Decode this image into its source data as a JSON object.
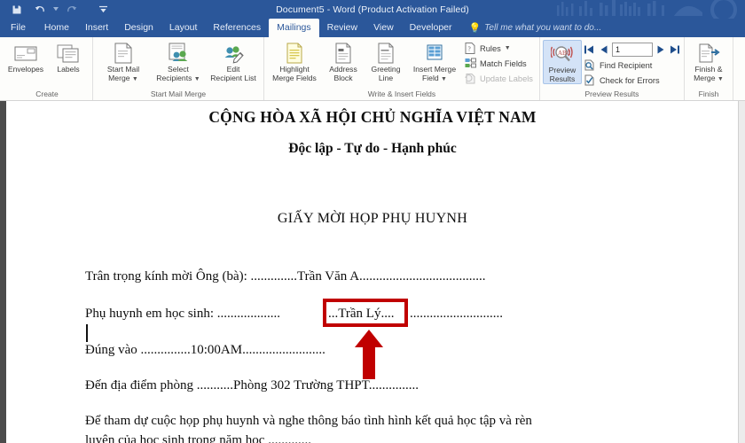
{
  "window": {
    "title": "Document5 - Word (Product Activation Failed)",
    "accent_color": "#2b579a"
  },
  "quick_access": {
    "items": [
      {
        "name": "save",
        "label": "Save"
      },
      {
        "name": "undo",
        "label": "Undo"
      },
      {
        "name": "redo",
        "label": "Repeat"
      },
      {
        "name": "customize",
        "label": "Customize Quick Access Toolbar"
      }
    ]
  },
  "tabs": [
    {
      "label": "File",
      "active": false
    },
    {
      "label": "Home",
      "active": false
    },
    {
      "label": "Insert",
      "active": false
    },
    {
      "label": "Design",
      "active": false
    },
    {
      "label": "Layout",
      "active": false
    },
    {
      "label": "References",
      "active": false
    },
    {
      "label": "Mailings",
      "active": true
    },
    {
      "label": "Review",
      "active": false
    },
    {
      "label": "View",
      "active": false
    },
    {
      "label": "Developer",
      "active": false
    }
  ],
  "tell_me": {
    "placeholder": "Tell me what you want to do..."
  },
  "ribbon": {
    "groups": [
      {
        "label": "Create",
        "buttons": [
          {
            "label": "Envelopes",
            "icon": "envelope-icon",
            "dropdown": false
          },
          {
            "label": "Labels",
            "icon": "labels-icon",
            "dropdown": false
          }
        ]
      },
      {
        "label": "Start Mail Merge",
        "buttons": [
          {
            "label": "Start Mail\nMerge",
            "line1": "Start Mail",
            "line2": "Merge",
            "icon": "start-mail-merge-icon",
            "dropdown": true
          },
          {
            "label": "Select\nRecipients",
            "line1": "Select",
            "line2": "Recipients",
            "icon": "select-recipients-icon",
            "dropdown": true
          },
          {
            "label": "Edit\nRecipient List",
            "line1": "Edit",
            "line2": "Recipient List",
            "icon": "edit-recipient-list-icon",
            "dropdown": false
          }
        ]
      },
      {
        "label": "Write & Insert Fields",
        "buttons": [
          {
            "line1": "Highlight",
            "line2": "Merge Fields",
            "icon": "highlight-merge-fields-icon",
            "dropdown": false
          },
          {
            "line1": "Address",
            "line2": "Block",
            "icon": "address-block-icon",
            "dropdown": false
          },
          {
            "line1": "Greeting",
            "line2": "Line",
            "icon": "greeting-line-icon",
            "dropdown": false
          },
          {
            "line1": "Insert Merge",
            "line2": "Field",
            "icon": "insert-merge-field-icon",
            "dropdown": true
          }
        ],
        "small_buttons": [
          {
            "label": "Rules",
            "icon": "rules-icon",
            "dropdown": true,
            "disabled": false
          },
          {
            "label": "Match Fields",
            "icon": "match-fields-icon",
            "dropdown": false,
            "disabled": false
          },
          {
            "label": "Update Labels",
            "icon": "update-labels-icon",
            "dropdown": false,
            "disabled": true
          }
        ]
      },
      {
        "label": "Preview Results",
        "buttons": [
          {
            "line1": "Preview",
            "line2": "Results",
            "icon": "preview-results-icon",
            "dropdown": false,
            "selected": true
          }
        ],
        "record_nav": {
          "first_label": "First Record",
          "prev_label": "Previous Record",
          "value": "1",
          "next_label": "Next Record",
          "last_label": "Last Record"
        },
        "small_buttons": [
          {
            "label": "Find Recipient",
            "icon": "find-recipient-icon",
            "dropdown": false,
            "disabled": false
          },
          {
            "label": "Check for Errors",
            "icon": "check-for-errors-icon",
            "dropdown": false,
            "disabled": false
          }
        ]
      },
      {
        "label": "Finish",
        "buttons": [
          {
            "line1": "Finish &",
            "line2": "Merge",
            "icon": "finish-and-merge-icon",
            "dropdown": true
          }
        ]
      }
    ]
  },
  "document": {
    "lines": [
      {
        "id": "heading-country",
        "text": "CỘNG HÒA XÃ HỘI CHỦ NGHĨA VIỆT NAM"
      },
      {
        "id": "heading-motto",
        "text": "Độc lập - Tự do - Hạnh phúc"
      },
      {
        "id": "heading-title",
        "text": "GIẤY MỜI HỌP PHỤ HUYNH"
      },
      {
        "id": "line-parent-name",
        "text": "Trân trọng kính mời Ông (bà): ..............Trần Văn A......................................"
      },
      {
        "id": "line-student-pre",
        "text": "Phụ huynh em học sinh: ..................."
      },
      {
        "id": "line-student-merged",
        "text": "...Trần Lý...."
      },
      {
        "id": "line-student-post",
        "text": "............................"
      },
      {
        "id": "line-time",
        "text": "Đúng vào ...............10:00AM........................."
      },
      {
        "id": "line-place",
        "text": "Đến địa điểm phòng ...........Phòng 302 Trường THPT..............."
      },
      {
        "id": "line-purpose-1",
        "text": "Để tham dự cuộc họp phụ huynh và nghe thông báo tình hình kết quả học tập và rèn"
      },
      {
        "id": "line-purpose-2",
        "text": "luyện của học sinh trong năm học ............."
      }
    ]
  },
  "annotation": {
    "highlight_color": "#c00000",
    "box_target": "line-student-merged",
    "arrow_direction": "up"
  }
}
